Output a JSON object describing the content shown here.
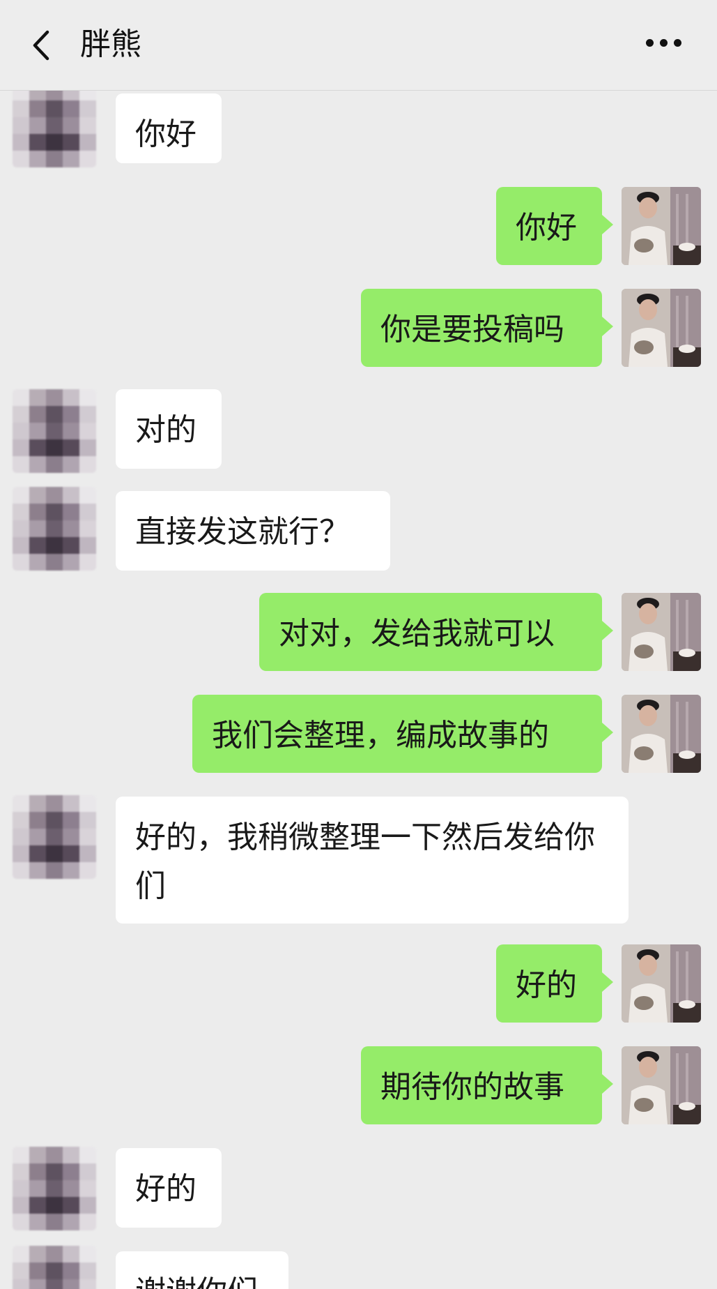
{
  "header": {
    "title": "胖熊",
    "back_icon": "chevron-left-icon",
    "more_icon": "more-dots-icon"
  },
  "colors": {
    "background": "#ececec",
    "outgoing_bubble": "#95ec69",
    "incoming_bubble": "#ffffff"
  },
  "messages": [
    {
      "side": "in",
      "text": "你好"
    },
    {
      "side": "out",
      "text": "你好"
    },
    {
      "side": "out",
      "text": "你是要投稿吗"
    },
    {
      "side": "in",
      "text": "对的"
    },
    {
      "side": "in",
      "text": "直接发这就行？"
    },
    {
      "side": "out",
      "text": "对对，发给我就可以"
    },
    {
      "side": "out",
      "text": "我们会整理，编成故事的"
    },
    {
      "side": "in",
      "text": "好的，我稍微整理一下然后发给你们"
    },
    {
      "side": "out",
      "text": "好的"
    },
    {
      "side": "out",
      "text": "期待你的故事"
    },
    {
      "side": "in",
      "text": "好的"
    },
    {
      "side": "in",
      "text": "谢谢你们"
    }
  ]
}
